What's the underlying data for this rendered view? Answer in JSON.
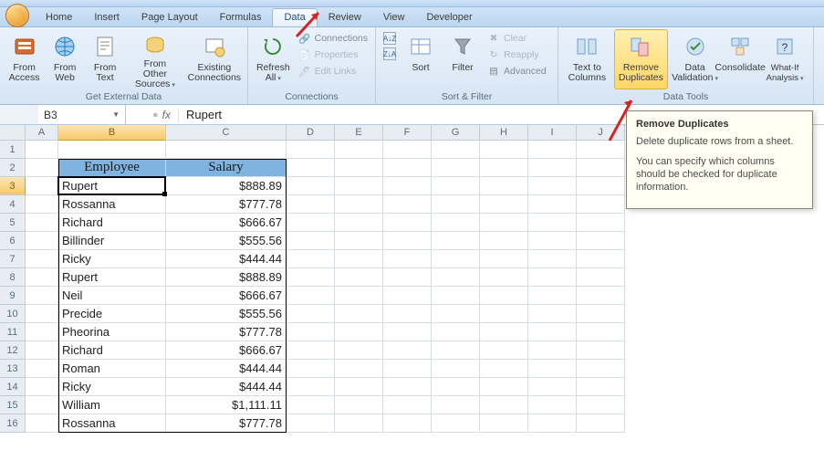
{
  "tabs": [
    "Home",
    "Insert",
    "Page Layout",
    "Formulas",
    "Data",
    "Review",
    "View",
    "Developer"
  ],
  "active_tab_index": 4,
  "ribbon": {
    "ext_data": {
      "label": "Get External Data",
      "access": "From Access",
      "web": "From Web",
      "text": "From Text",
      "other": "From Other Sources",
      "existing": "Existing Connections"
    },
    "connections": {
      "label": "Connections",
      "refresh": "Refresh All",
      "conn": "Connections",
      "props": "Properties",
      "links": "Edit Links"
    },
    "sortfilter": {
      "label": "Sort & Filter",
      "sort": "Sort",
      "filter": "Filter",
      "clear": "Clear",
      "reapply": "Reapply",
      "advanced": "Advanced"
    },
    "datatools": {
      "label": "Data Tools",
      "t2c": "Text to Columns",
      "dup": "Remove Duplicates",
      "valid": "Data Validation",
      "consol": "Consolidate",
      "whatif": "What-If Analysis"
    }
  },
  "namebox": "B3",
  "formula": "Rupert",
  "columns": [
    "A",
    "B",
    "C",
    "D",
    "E",
    "F",
    "G",
    "H",
    "I",
    "J"
  ],
  "selected_col_index": 1,
  "selected_row_index": 3,
  "header": {
    "employee": "Employee",
    "salary": "Salary"
  },
  "rows": [
    {
      "employee": "Rupert",
      "salary": "$888.89"
    },
    {
      "employee": "Rossanna",
      "salary": "$777.78"
    },
    {
      "employee": "Richard",
      "salary": "$666.67"
    },
    {
      "employee": "Billinder",
      "salary": "$555.56"
    },
    {
      "employee": "Ricky",
      "salary": "$444.44"
    },
    {
      "employee": "Rupert",
      "salary": "$888.89"
    },
    {
      "employee": "Neil",
      "salary": "$666.67"
    },
    {
      "employee": "Precide",
      "salary": "$555.56"
    },
    {
      "employee": "Pheorina",
      "salary": "$777.78"
    },
    {
      "employee": "Richard",
      "salary": "$666.67"
    },
    {
      "employee": "Roman",
      "salary": "$444.44"
    },
    {
      "employee": "Ricky",
      "salary": "$444.44"
    },
    {
      "employee": "William",
      "salary": "$1,111.11"
    },
    {
      "employee": "Rossanna",
      "salary": "$777.78"
    }
  ],
  "tooltip": {
    "title": "Remove Duplicates",
    "p1": "Delete duplicate rows from a sheet.",
    "p2": "You can specify which columns should be checked for duplicate information."
  }
}
